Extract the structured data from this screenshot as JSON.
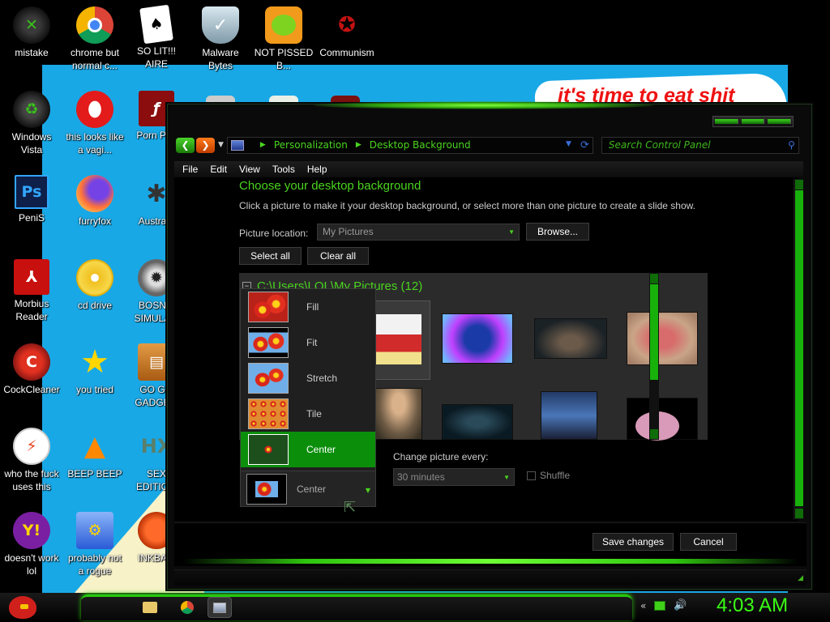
{
  "desktop": {
    "wallpaper_text": "it's time to eat shit",
    "icons": [
      {
        "label": "mistake",
        "icon": "xbox-icon"
      },
      {
        "label": "chrome but normal c...",
        "icon": "chrome-icon"
      },
      {
        "label": "SO LIT!!! AIRE",
        "icon": "solitaire-icon"
      },
      {
        "label": "Malware Bytes",
        "icon": "shield-icon"
      },
      {
        "label": "NOT PISSED B...",
        "icon": "angry-pig-icon"
      },
      {
        "label": "Communism",
        "icon": "flag-icon"
      },
      {
        "label": "Windows Vista",
        "icon": "recycle-bin-icon"
      },
      {
        "label": "this looks like a vagi...",
        "icon": "opera-icon"
      },
      {
        "label": "Porn Pl...",
        "icon": "flash-icon"
      },
      {
        "label": "PeniS",
        "icon": "photoshop-icon"
      },
      {
        "label": "furryfox",
        "icon": "firefox-icon"
      },
      {
        "label": "Austra...",
        "icon": "spider-icon"
      },
      {
        "label": "Morbius Reader",
        "icon": "pdf-icon"
      },
      {
        "label": "cd drive",
        "icon": "cd-icon"
      },
      {
        "label": "BOSN... SIMULA...",
        "icon": "mine-icon"
      },
      {
        "label": "CockCleaner",
        "icon": "ccleaner-icon"
      },
      {
        "label": "you tried",
        "icon": "star-icon"
      },
      {
        "label": "GO G... GADGE...",
        "icon": "briefcase-icon"
      },
      {
        "label": "who the fuck uses this",
        "icon": "lightning-icon"
      },
      {
        "label": "BEEP BEEP",
        "icon": "vlc-icon"
      },
      {
        "label": "SEX EDITIO...",
        "icon": "hx-icon"
      },
      {
        "label": "doesn't work lol",
        "icon": "yahoo-icon"
      },
      {
        "label": "probably not a rogue",
        "icon": "gears-icon"
      },
      {
        "label": "INKBA...",
        "icon": "ink-icon"
      }
    ]
  },
  "window": {
    "breadcrumb": [
      "Personalization",
      "Desktop Background"
    ],
    "search_placeholder": "Search Control Panel",
    "menu": [
      "File",
      "Edit",
      "View",
      "Tools",
      "Help"
    ],
    "title": "Choose your desktop background",
    "subtitle": "Click a picture to make it your desktop background, or select more than one picture to create a slide show.",
    "picture_location_label": "Picture location:",
    "picture_location_value": "My Pictures",
    "browse_label": "Browse...",
    "select_all_label": "Select all",
    "clear_all_label": "Clear all",
    "folder_header": "C:\\Users\\LOL\\My Pictures (12)",
    "position_options": [
      "Fill",
      "Fit",
      "Stretch",
      "Tile",
      "Center"
    ],
    "position_selected": "Center",
    "change_picture_label": "Change picture every:",
    "interval_value": "30 minutes",
    "shuffle_label": "Shuffle",
    "save_label": "Save changes",
    "cancel_label": "Cancel"
  },
  "taskbar": {
    "clock": "4:03 AM",
    "items": [
      "folder-icon",
      "chrome-icon",
      "control-panel-icon"
    ]
  }
}
